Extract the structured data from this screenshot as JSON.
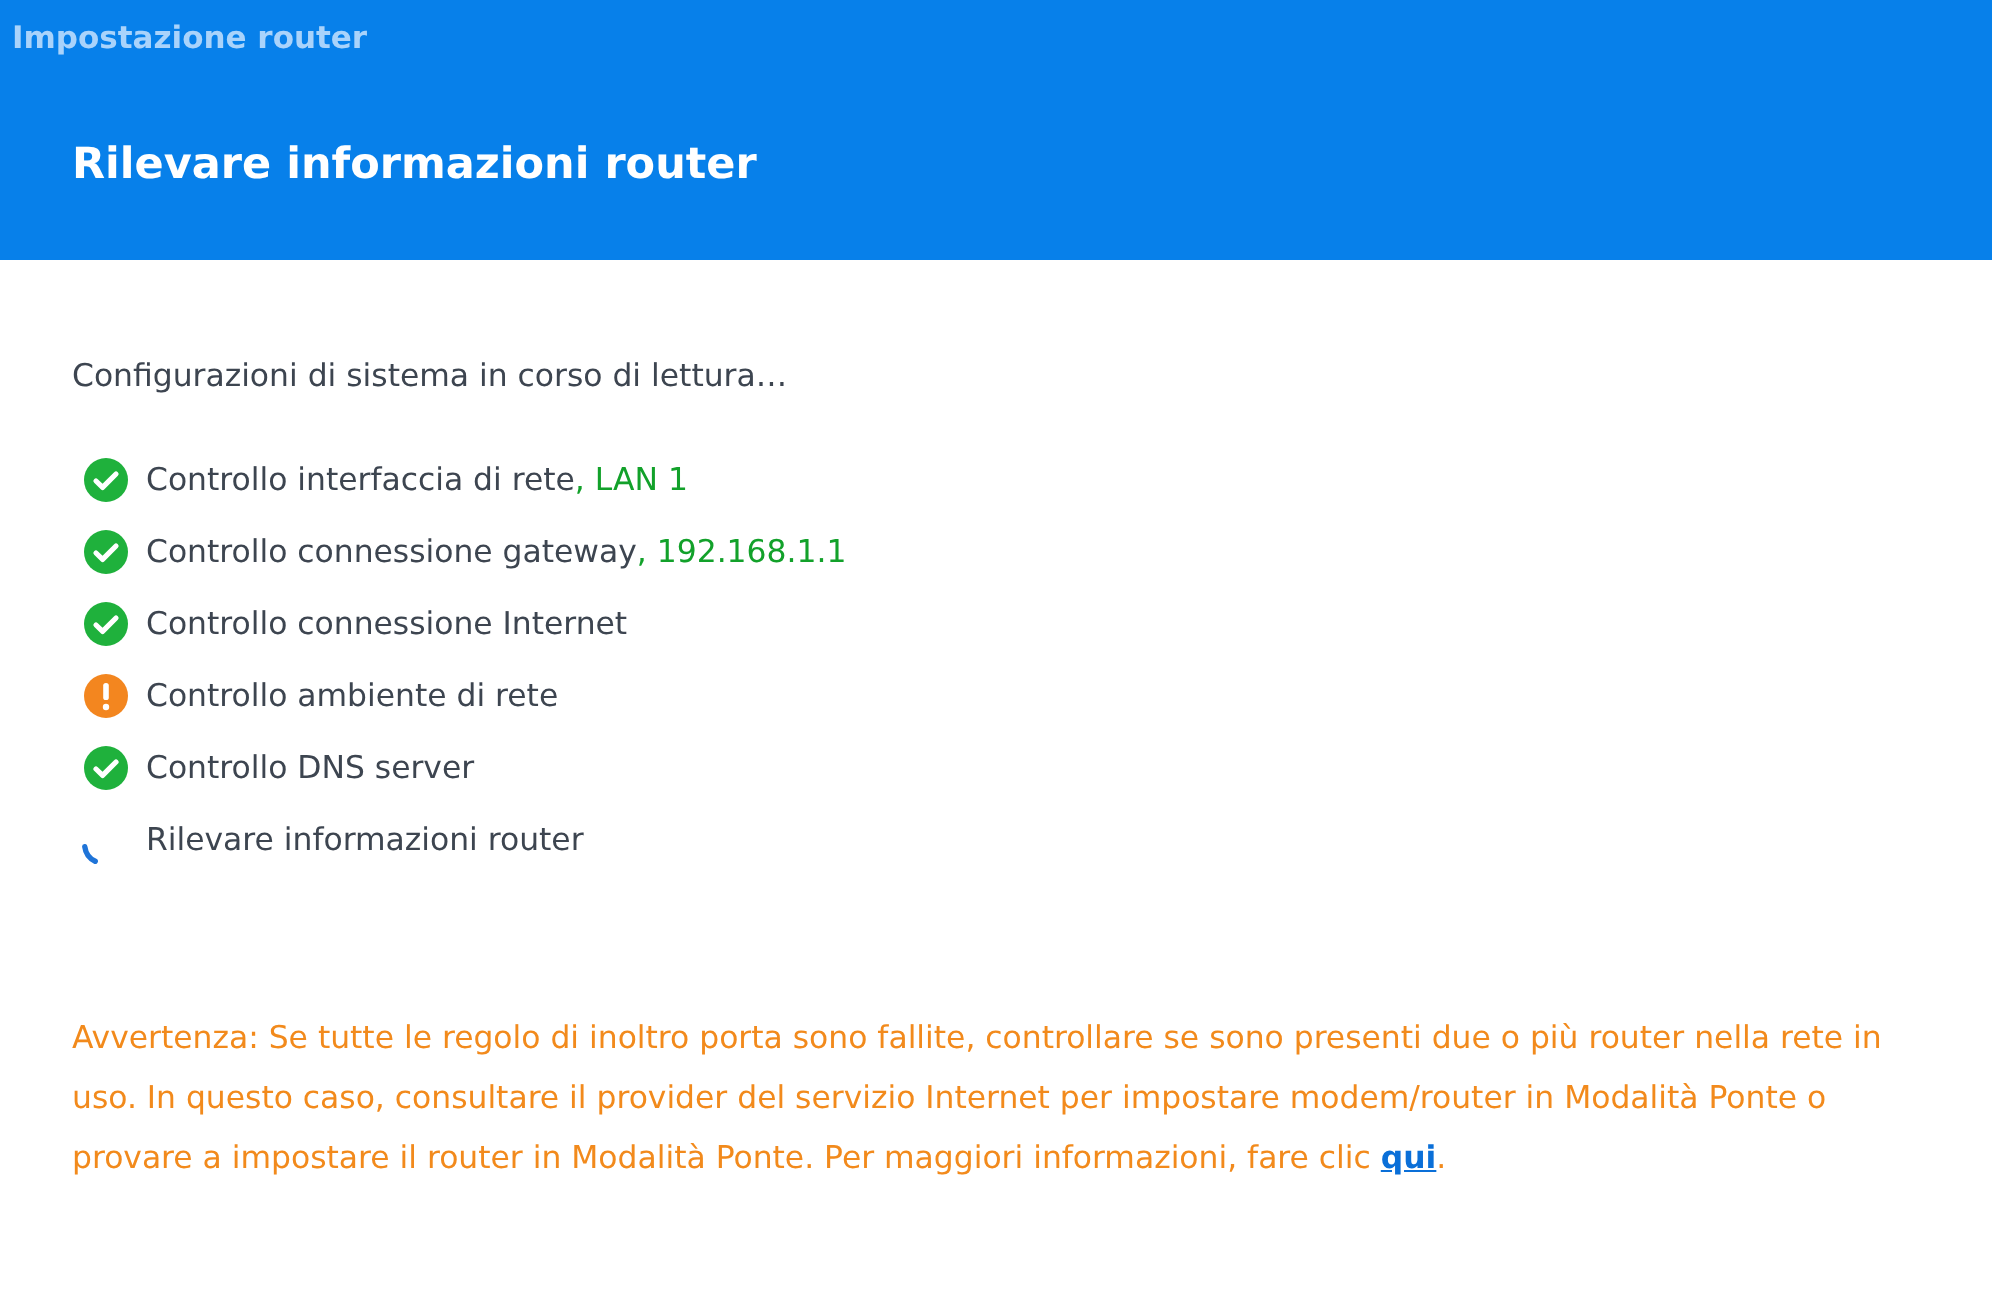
{
  "window": {
    "title": "Impostazione router"
  },
  "heading": "Rilevare informazioni router",
  "intro": "Configurazioni di sistema in corso di lettura…",
  "steps": [
    {
      "kind": "ok",
      "label": "Controllo interfaccia di rete",
      "detail": ", LAN 1"
    },
    {
      "kind": "ok",
      "label": "Controllo connessione gateway",
      "detail": ", 192.168.1.1"
    },
    {
      "kind": "ok",
      "label": "Controllo connessione Internet"
    },
    {
      "kind": "warning",
      "label": "Controllo ambiente di rete"
    },
    {
      "kind": "ok",
      "label": "Controllo DNS server"
    },
    {
      "kind": "loading",
      "label": "Rilevare informazioni router"
    }
  ],
  "warning": {
    "text": "Avvertenza: Se tutte le regolo di inoltro porta sono fallite, controllare se sono presenti due o più router nella rete in uso. In questo caso, consultare il provider del servizio Internet per impostare modem/router in Modalità Ponte o provare a impostare il router in Modalità Ponte. Per maggiori informazioni, fare clic ",
    "link": "qui",
    "after": "."
  }
}
